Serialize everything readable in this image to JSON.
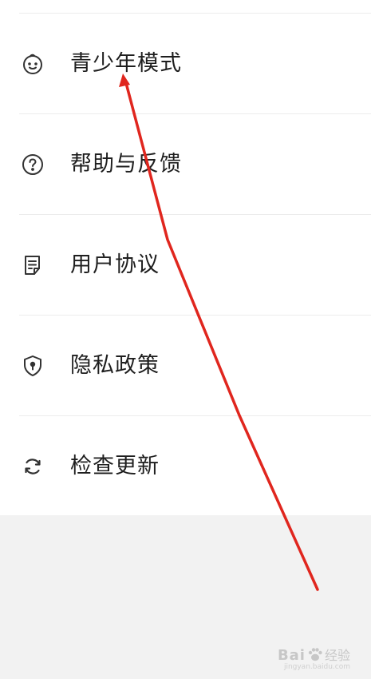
{
  "menu": {
    "items": [
      {
        "label": "青少年模式",
        "icon": "child-face-icon"
      },
      {
        "label": "帮助与反馈",
        "icon": "help-circle-icon"
      },
      {
        "label": "用户协议",
        "icon": "document-icon"
      },
      {
        "label": "隐私政策",
        "icon": "shield-lock-icon"
      },
      {
        "label": "检查更新",
        "icon": "refresh-icon"
      }
    ]
  },
  "annotation": {
    "arrow_color": "#e0261e"
  },
  "watermark": {
    "brand_left": "Bai",
    "brand_right": "经验",
    "sub_text": "jingyan.baidu.com"
  },
  "colors": {
    "background": "#f2f2f2",
    "card": "#ffffff",
    "text": "#1e1e1e",
    "divider": "#ececec",
    "icon": "#333333"
  }
}
